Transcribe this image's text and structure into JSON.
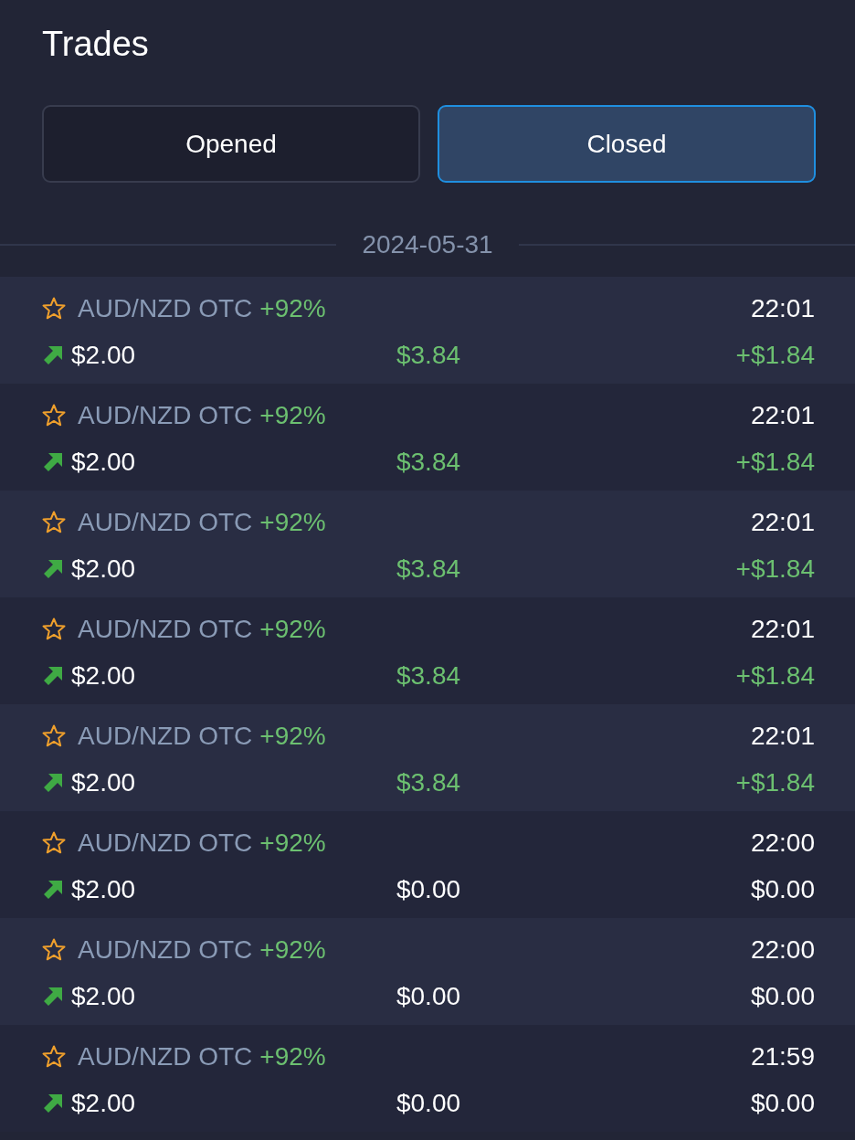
{
  "title": "Trades",
  "tabs": [
    {
      "label": "Opened",
      "selected": false
    },
    {
      "label": "Closed",
      "selected": true
    }
  ],
  "date": "2024-05-31",
  "trades": [
    {
      "pair": "AUD/NZD OTC",
      "payout_rate": "+92%",
      "time": "22:01",
      "up": true,
      "amount": "$2.00",
      "payout": "$3.84",
      "profit": "+$1.84",
      "won": true
    },
    {
      "pair": "AUD/NZD OTC",
      "payout_rate": "+92%",
      "time": "22:01",
      "up": true,
      "amount": "$2.00",
      "payout": "$3.84",
      "profit": "+$1.84",
      "won": true
    },
    {
      "pair": "AUD/NZD OTC",
      "payout_rate": "+92%",
      "time": "22:01",
      "up": true,
      "amount": "$2.00",
      "payout": "$3.84",
      "profit": "+$1.84",
      "won": true
    },
    {
      "pair": "AUD/NZD OTC",
      "payout_rate": "+92%",
      "time": "22:01",
      "up": true,
      "amount": "$2.00",
      "payout": "$3.84",
      "profit": "+$1.84",
      "won": true
    },
    {
      "pair": "AUD/NZD OTC",
      "payout_rate": "+92%",
      "time": "22:01",
      "up": true,
      "amount": "$2.00",
      "payout": "$3.84",
      "profit": "+$1.84",
      "won": true
    },
    {
      "pair": "AUD/NZD OTC",
      "payout_rate": "+92%",
      "time": "22:00",
      "up": true,
      "amount": "$2.00",
      "payout": "$0.00",
      "profit": "$0.00",
      "won": false
    },
    {
      "pair": "AUD/NZD OTC",
      "payout_rate": "+92%",
      "time": "22:00",
      "up": true,
      "amount": "$2.00",
      "payout": "$0.00",
      "profit": "$0.00",
      "won": false
    },
    {
      "pair": "AUD/NZD OTC",
      "payout_rate": "+92%",
      "time": "21:59",
      "up": true,
      "amount": "$2.00",
      "payout": "$0.00",
      "profit": "$0.00",
      "won": false
    }
  ]
}
